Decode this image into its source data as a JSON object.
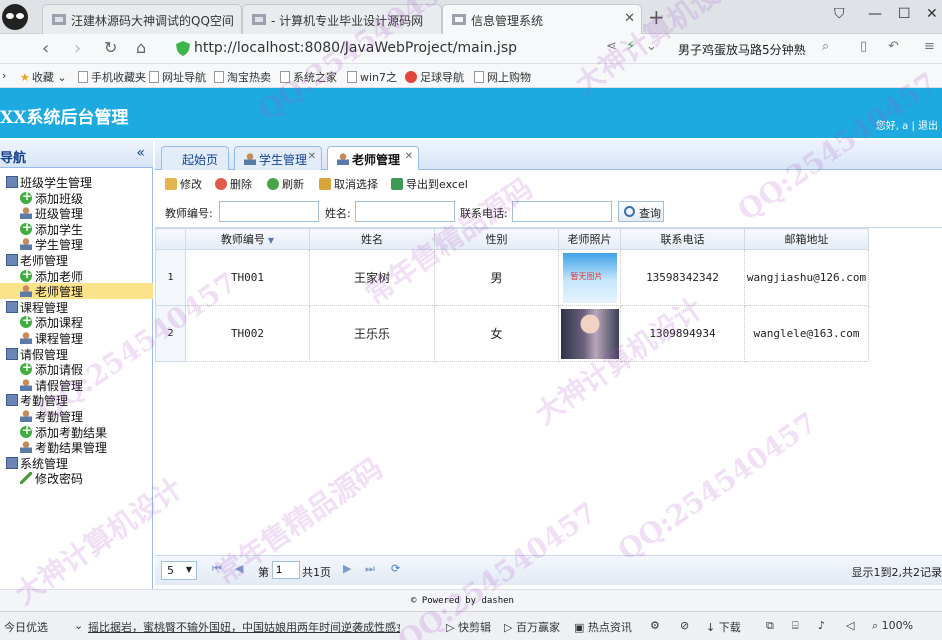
{
  "browser": {
    "tabs": [
      {
        "label": "汪建林源码大神调试的QQ空间"
      },
      {
        "label": "- 计算机专业毕业设计源码网"
      },
      {
        "label": "信息管理系统"
      }
    ],
    "url": "http://localhost:8080/JavaWebProject/main.jsp",
    "headline": "男子鸡蛋放马路5分钟熟",
    "bookmarks": [
      "收藏",
      "手机收藏夹",
      "网址导航",
      "淘宝热卖",
      "系统之家",
      "win7之",
      "足球导航",
      "网上购物"
    ]
  },
  "app": {
    "title": "XX系统后台管理",
    "user_greeting": "您好, a",
    "logout": "| 退出"
  },
  "sidebar": {
    "title": "导航",
    "collapse": "«",
    "items": [
      {
        "label": "班级学生管理",
        "level": 0,
        "icon": "monitor-icon"
      },
      {
        "label": "添加班级",
        "level": 1,
        "icon": "add-icon"
      },
      {
        "label": "班级管理",
        "level": 1,
        "icon": "person-icon"
      },
      {
        "label": "添加学生",
        "level": 1,
        "icon": "add-icon"
      },
      {
        "label": "学生管理",
        "level": 1,
        "icon": "person-icon"
      },
      {
        "label": "老师管理",
        "level": 0,
        "icon": "monitor-icon"
      },
      {
        "label": "添加老师",
        "level": 1,
        "icon": "add-icon"
      },
      {
        "label": "老师管理",
        "level": 1,
        "icon": "person-icon",
        "selected": true
      },
      {
        "label": "课程管理",
        "level": 0,
        "icon": "monitor-icon"
      },
      {
        "label": "添加课程",
        "level": 1,
        "icon": "add-icon"
      },
      {
        "label": "课程管理",
        "level": 1,
        "icon": "person-icon"
      },
      {
        "label": "请假管理",
        "level": 0,
        "icon": "monitor-icon"
      },
      {
        "label": "添加请假",
        "level": 1,
        "icon": "add-icon"
      },
      {
        "label": "请假管理",
        "level": 1,
        "icon": "person-icon"
      },
      {
        "label": "考勤管理",
        "level": 0,
        "icon": "monitor-icon"
      },
      {
        "label": "考勤管理",
        "level": 1,
        "icon": "person-icon"
      },
      {
        "label": "添加考勤结果",
        "level": 1,
        "icon": "add-icon"
      },
      {
        "label": "考勤结果管理",
        "level": 1,
        "icon": "person-icon"
      },
      {
        "label": "系统管理",
        "level": 0,
        "icon": "monitor-icon"
      },
      {
        "label": "修改密码",
        "level": 1,
        "icon": "pencil-icon"
      }
    ]
  },
  "tabs": [
    {
      "label": "起始页"
    },
    {
      "label": "学生管理"
    },
    {
      "label": "老师管理"
    }
  ],
  "toolbar": {
    "edit": "修改",
    "delete": "删除",
    "refresh": "刷新",
    "cancel_select": "取消选择",
    "export": "导出到excel"
  },
  "search": {
    "teacher_no_label": "教师编号:",
    "name_label": "姓名:",
    "phone_label": "联系电话:",
    "query_button": "查询",
    "teacher_no_value": "",
    "name_value": "",
    "phone_value": ""
  },
  "grid": {
    "columns": [
      "教师编号",
      "姓名",
      "性别",
      "老师照片",
      "联系电话",
      "邮箱地址"
    ],
    "rows": [
      {
        "num": "1",
        "teacher_no": "TH001",
        "name": "王家树",
        "gender": "男",
        "photo_text": "暂无图片",
        "phone": "13598342342",
        "email": "wangjiashu@126.com"
      },
      {
        "num": "2",
        "teacher_no": "TH002",
        "name": "王乐乐",
        "gender": "女",
        "photo_text": "",
        "phone": "1309894934",
        "email": "wanglele@163.com"
      }
    ]
  },
  "pager": {
    "page_size": "5",
    "page_prefix": "第",
    "page_value": "1",
    "page_total": "共1页",
    "info": "显示1到2,共2记录"
  },
  "footer": "© Powered by dashen",
  "statusbar": {
    "left": "今日优选",
    "news": "摇比据岩，蜜桃臀不输外国妞，中国姑娘用两年时间逆袭成性感女神",
    "items": [
      "快剪辑",
      "百万赢家",
      "热点资讯",
      "下载",
      "100%"
    ]
  },
  "watermarks": [
    "QQ:254540457",
    "常年售精品源码",
    "大神计算机设计"
  ],
  "colors": {
    "header": "#1caae0",
    "selected_node": "#fbe38c",
    "panel_border": "#99bbe8"
  }
}
